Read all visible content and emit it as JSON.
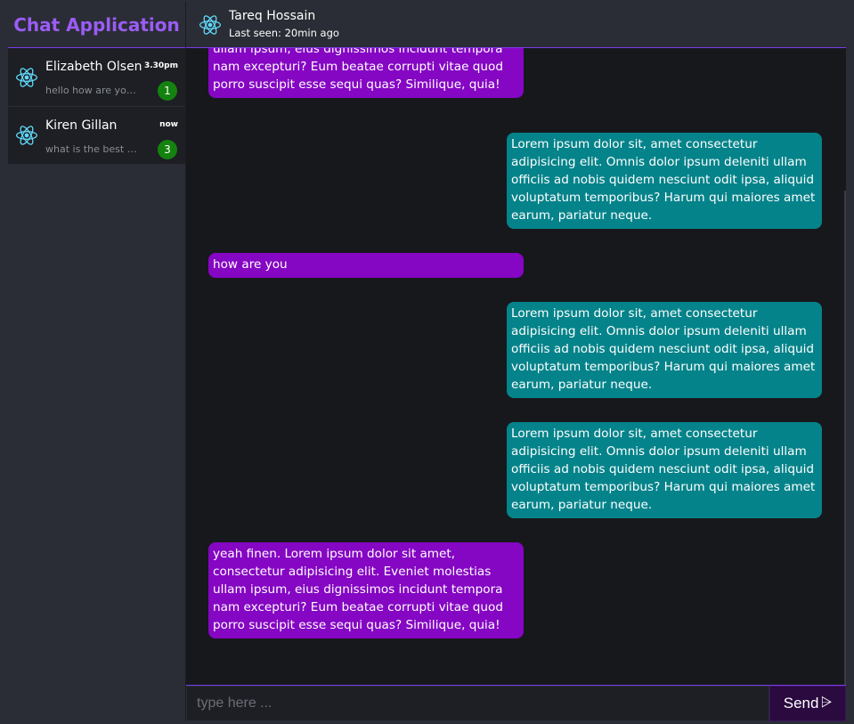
{
  "app": {
    "title": "Chat Application"
  },
  "contacts": [
    {
      "name": "Elizabeth Olsen",
      "time": "3.30pm",
      "preview": "hello how are you doing",
      "unread": "1"
    },
    {
      "name": "Kiren Gillan",
      "time": "now",
      "preview": "what is the best way to learn",
      "unread": "3"
    }
  ],
  "chat": {
    "name": "Tareq Hossain",
    "status": "Last seen: 20min ago",
    "messages": [
      {
        "side": "in",
        "text": "yeah finen. Lorem ipsum dolor sit amet, consectetur adipisicing elit. Eveniet molestias ullam ipsum, eius dignissimos incidunt tempora nam excepturi? Eum beatae corrupti vitae quod porro suscipit esse sequi quas? Similique, quia!"
      },
      {
        "side": "out",
        "text": "Lorem ipsum dolor sit, amet consectetur adipisicing elit. Omnis dolor ipsum deleniti ullam officiis ad nobis quidem nesciunt odit ipsa, aliquid voluptatum temporibus? Harum qui maiores amet earum, pariatur neque."
      },
      {
        "side": "in",
        "text": "how are you"
      },
      {
        "side": "out",
        "text": "Lorem ipsum dolor sit, amet consectetur adipisicing elit. Omnis dolor ipsum deleniti ullam officiis ad nobis quidem nesciunt odit ipsa, aliquid voluptatum temporibus? Harum qui maiores amet earum, pariatur neque."
      },
      {
        "side": "out",
        "text": "Lorem ipsum dolor sit, amet consectetur adipisicing elit. Omnis dolor ipsum deleniti ullam officiis ad nobis quidem nesciunt odit ipsa, aliquid voluptatum temporibus? Harum qui maiores amet earum, pariatur neque."
      },
      {
        "side": "in",
        "text": "yeah finen. Lorem ipsum dolor sit amet, consectetur adipisicing elit. Eveniet molestias ullam ipsum, eius dignissimos incidunt tempora nam excepturi? Eum beatae corrupti vitae quod porro suscipit esse sequi quas? Similique, quia!"
      }
    ]
  },
  "composer": {
    "placeholder": "type here ...",
    "send_label": "Send",
    "send_icon": "⩥"
  },
  "colors": {
    "accent": "#9b5cf6",
    "incoming": "#8506c3",
    "outgoing": "#05838a",
    "badge": "#14820f",
    "react": "#61dafb"
  }
}
